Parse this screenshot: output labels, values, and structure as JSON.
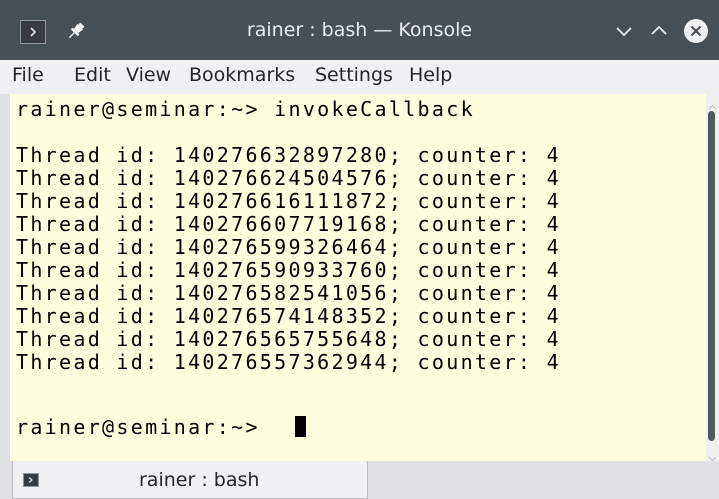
{
  "window": {
    "title": "rainer : bash — Konsole",
    "icons": {
      "app": "konsole-icon",
      "pin": "pin-icon",
      "minimize": "chevron-down-icon",
      "maximize": "chevron-up-icon",
      "close": "close-icon"
    }
  },
  "menubar": {
    "items": [
      "File",
      "Edit",
      "View",
      "Bookmarks",
      "Settings",
      "Help"
    ]
  },
  "terminal": {
    "background_color": "#ffffdd",
    "text_color": "#000000",
    "lines": [
      "rainer@seminar:~> invokeCallback",
      "",
      "Thread id: 140276632897280; counter: 4",
      "Thread id: 140276624504576; counter: 4",
      "Thread id: 140276616111872; counter: 4",
      "Thread id: 140276607719168; counter: 4",
      "Thread id: 140276599326464; counter: 4",
      "Thread id: 140276590933760; counter: 4",
      "Thread id: 140276582541056; counter: 4",
      "Thread id: 140276574148352; counter: 4",
      "Thread id: 140276565755648; counter: 4",
      "Thread id: 140276557362944; counter: 4",
      "",
      "rainer@seminar:~> "
    ]
  },
  "tabs": [
    {
      "label": "rainer : bash",
      "icon": "terminal-icon",
      "active": true
    }
  ],
  "colors": {
    "titlebar": "#475057",
    "menubar": "#eff0f1",
    "terminal_bg": "#ffffdd"
  }
}
